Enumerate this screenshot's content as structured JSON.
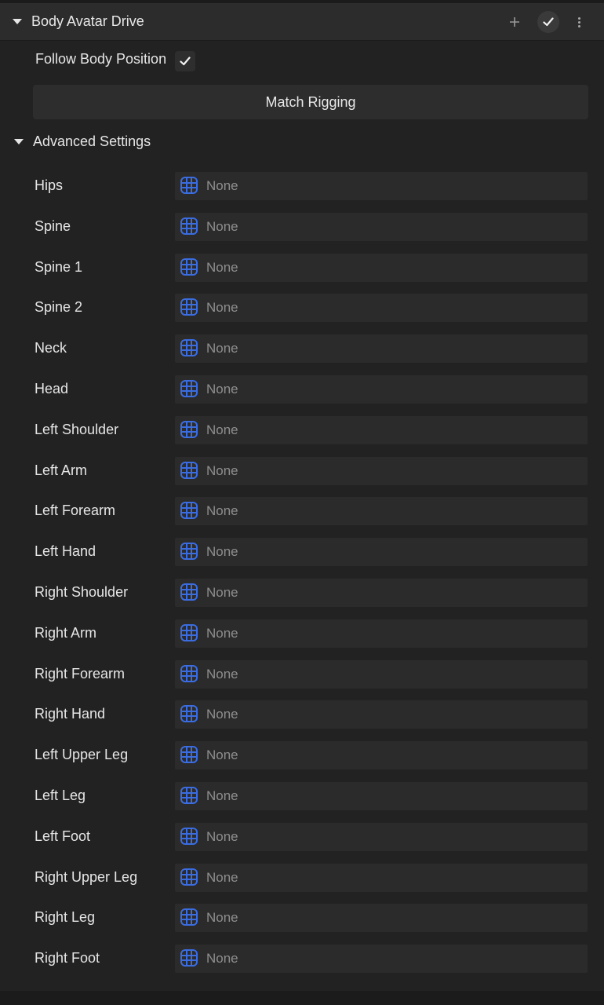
{
  "component": {
    "title": "Body Avatar Drive",
    "add_icon": "plus-icon",
    "enabled_icon": "check-icon",
    "menu_icon": "kebab-icon"
  },
  "follow": {
    "label": "Follow Body Position",
    "checked": true
  },
  "match_button_label": "Match Rigging",
  "advanced": {
    "title": "Advanced Settings",
    "bones": [
      {
        "label": "Hips",
        "value": "None"
      },
      {
        "label": "Spine",
        "value": "None"
      },
      {
        "label": "Spine 1",
        "value": "None"
      },
      {
        "label": "Spine 2",
        "value": "None"
      },
      {
        "label": "Neck",
        "value": "None"
      },
      {
        "label": "Head",
        "value": "None"
      },
      {
        "label": "Left Shoulder",
        "value": "None"
      },
      {
        "label": "Left Arm",
        "value": "None"
      },
      {
        "label": "Left Forearm",
        "value": "None"
      },
      {
        "label": "Left Hand",
        "value": "None"
      },
      {
        "label": "Right Shoulder",
        "value": "None"
      },
      {
        "label": "Right Arm",
        "value": "None"
      },
      {
        "label": "Right Forearm",
        "value": "None"
      },
      {
        "label": "Right Hand",
        "value": "None"
      },
      {
        "label": "Left Upper Leg",
        "value": "None"
      },
      {
        "label": "Left Leg",
        "value": "None"
      },
      {
        "label": "Left Foot",
        "value": "None"
      },
      {
        "label": "Right Upper Leg",
        "value": "None"
      },
      {
        "label": "Right Leg",
        "value": "None"
      },
      {
        "label": "Right Foot",
        "value": "None"
      }
    ]
  },
  "colors": {
    "accent_icon": "#3b6de0",
    "panel_bg": "#222222",
    "header_bg": "#2c2c2c",
    "field_bg": "#2b2b2b"
  }
}
